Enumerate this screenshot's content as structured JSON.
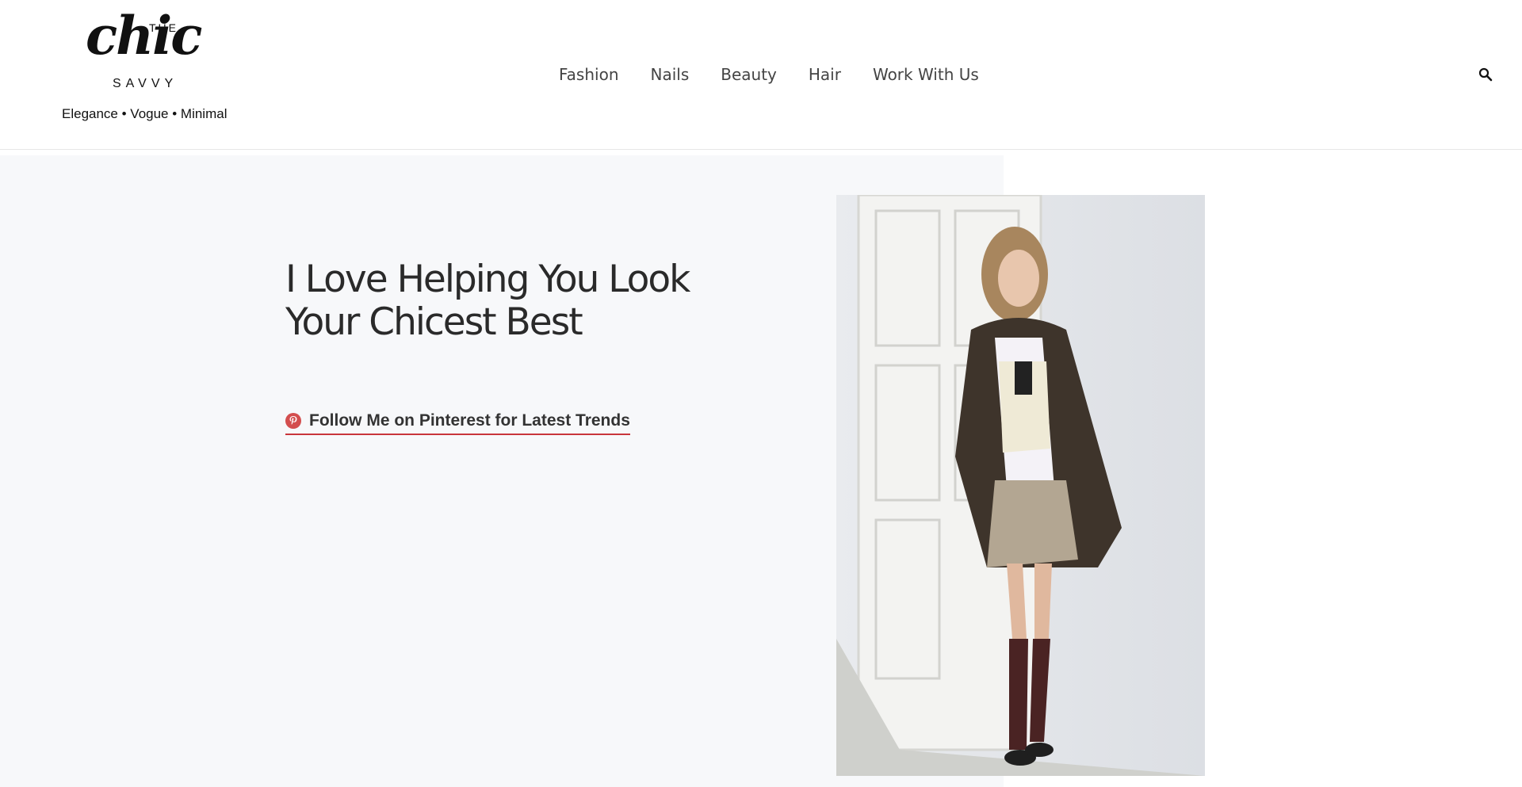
{
  "brand": {
    "logo_the": "THE",
    "logo_chic": "chic",
    "logo_savvy": "SAVVY",
    "tagline": "Elegance • Vogue • Minimal"
  },
  "nav": {
    "items": [
      {
        "label": "Fashion"
      },
      {
        "label": "Nails"
      },
      {
        "label": "Beauty"
      },
      {
        "label": "Hair"
      },
      {
        "label": "Work With Us"
      }
    ]
  },
  "header": {
    "search_icon": "search-icon"
  },
  "hero": {
    "headline": "I Love Helping You Look Your Chicest Best",
    "pinterest_link": "Follow Me on Pinterest for Latest Trends",
    "pinterest_icon": "pinterest-icon",
    "photo": "fashion-model-photo"
  },
  "colors": {
    "accent": "#c8353b",
    "hero_bg": "#f7f8fa",
    "text_dark": "#2a2a2a",
    "nav_text": "#444444"
  }
}
